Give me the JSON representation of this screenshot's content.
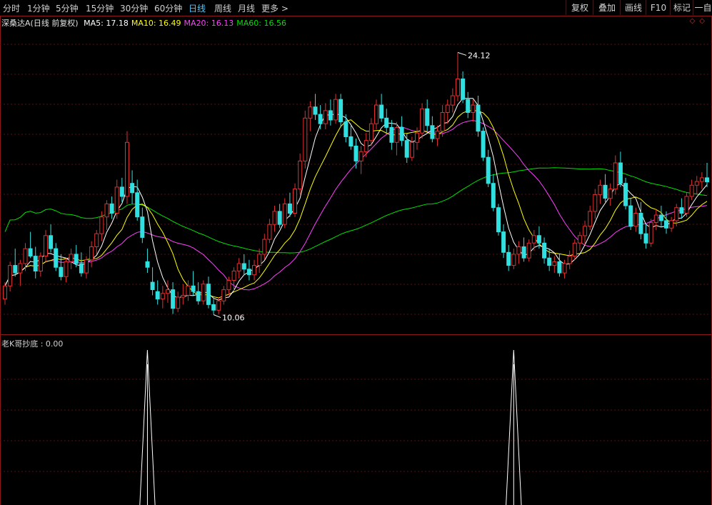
{
  "toolbar": {
    "periods": [
      "分时",
      "1分钟",
      "5分钟",
      "15分钟",
      "30分钟",
      "60分钟",
      "日线",
      "周线",
      "月线",
      "更多 >"
    ],
    "active_period": "日线",
    "right_buttons": [
      "复权",
      "叠加",
      "画线",
      "F10",
      "标记",
      "一自"
    ]
  },
  "main_chart": {
    "title": "深桑达A(日线 前复权)",
    "ma": [
      {
        "label": "MA5: 17.18",
        "color": "#ffffff"
      },
      {
        "label": "MA10: 16.49",
        "color": "#ffff00"
      },
      {
        "label": "MA20: 16.13",
        "color": "#ff40ff"
      },
      {
        "label": "MA60: 16.56",
        "color": "#00e000"
      }
    ],
    "diamonds": "◇◇"
  },
  "sub_chart": {
    "label": "老K哥抄底 : 0.00"
  },
  "chart_data": {
    "type": "candlestick",
    "title": "深桑达A(日线 前复权)",
    "price_range": [
      9.2,
      25.4
    ],
    "high_annotation": "24.12",
    "low_annotation": "10.06",
    "candle_colors": {
      "up": "#e03030",
      "down": "#30e0e0"
    },
    "ma_colors": {
      "MA5": "#ffffff",
      "MA10": "#ffff00",
      "MA20": "#ff40ff",
      "MA60": "#00e000"
    },
    "candles": [
      [
        10.9,
        11.8,
        10.6,
        11.6
      ],
      [
        11.6,
        12.9,
        11.3,
        12.7
      ],
      [
        12.7,
        13.6,
        12.1,
        12.3
      ],
      [
        12.3,
        13.0,
        11.6,
        12.8
      ],
      [
        12.8,
        13.9,
        12.4,
        13.6
      ],
      [
        13.6,
        14.5,
        13.1,
        13.2
      ],
      [
        13.2,
        13.7,
        12.0,
        12.4
      ],
      [
        12.4,
        13.4,
        12.1,
        13.2
      ],
      [
        13.2,
        14.6,
        12.9,
        14.3
      ],
      [
        14.3,
        14.9,
        13.4,
        13.6
      ],
      [
        13.6,
        13.9,
        12.4,
        12.6
      ],
      [
        12.6,
        13.3,
        11.9,
        12.1
      ],
      [
        12.1,
        13.1,
        11.8,
        12.9
      ],
      [
        12.9,
        13.6,
        12.5,
        13.3
      ],
      [
        13.3,
        13.8,
        12.6,
        12.8
      ],
      [
        12.8,
        13.4,
        12.1,
        12.3
      ],
      [
        12.3,
        13.2,
        12.0,
        13.0
      ],
      [
        13.0,
        14.0,
        12.6,
        13.7
      ],
      [
        13.7,
        14.6,
        13.3,
        14.4
      ],
      [
        14.4,
        15.6,
        14.0,
        15.3
      ],
      [
        15.3,
        16.2,
        14.6,
        16.0
      ],
      [
        16.0,
        16.4,
        15.2,
        15.5
      ],
      [
        15.5,
        17.3,
        15.2,
        16.9
      ],
      [
        16.9,
        17.4,
        16.1,
        16.4
      ],
      [
        16.4,
        19.9,
        16.0,
        19.3
      ],
      [
        17.1,
        17.8,
        16.0,
        16.6
      ],
      [
        16.6,
        17.3,
        15.1,
        15.3
      ],
      [
        15.3,
        15.8,
        13.9,
        14.2
      ],
      [
        12.9,
        13.6,
        12.3,
        12.6
      ],
      [
        11.8,
        12.6,
        11.1,
        11.4
      ],
      [
        11.3,
        11.9,
        10.6,
        10.9
      ],
      [
        10.9,
        11.6,
        10.4,
        11.2
      ],
      [
        11.2,
        11.9,
        10.7,
        11.4
      ],
      [
        11.4,
        11.8,
        10.1,
        10.4
      ],
      [
        10.4,
        11.3,
        10.2,
        11.0
      ],
      [
        11.0,
        11.7,
        10.6,
        11.1
      ],
      [
        11.1,
        11.9,
        10.8,
        11.6
      ],
      [
        11.6,
        12.4,
        11.1,
        11.3
      ],
      [
        11.3,
        11.8,
        10.6,
        10.8
      ],
      [
        10.8,
        11.9,
        10.6,
        11.7
      ],
      [
        11.7,
        12.1,
        10.4,
        10.6
      ],
      [
        10.6,
        10.9,
        10.06,
        10.3
      ],
      [
        10.3,
        11.0,
        10.1,
        10.8
      ],
      [
        10.8,
        11.6,
        10.6,
        11.4
      ],
      [
        11.4,
        12.1,
        11.1,
        11.9
      ],
      [
        11.9,
        12.6,
        11.3,
        12.4
      ],
      [
        12.4,
        13.1,
        12.0,
        12.8
      ],
      [
        12.8,
        13.3,
        12.2,
        12.5
      ],
      [
        12.5,
        13.0,
        11.9,
        12.2
      ],
      [
        12.2,
        13.0,
        11.9,
        12.7
      ],
      [
        12.7,
        13.6,
        12.3,
        13.3
      ],
      [
        13.3,
        14.4,
        13.0,
        14.1
      ],
      [
        14.1,
        15.2,
        13.9,
        14.9
      ],
      [
        14.9,
        15.9,
        14.5,
        15.6
      ],
      [
        15.6,
        16.0,
        14.7,
        14.9
      ],
      [
        14.9,
        16.3,
        14.7,
        16.0
      ],
      [
        16.0,
        16.6,
        15.3,
        15.5
      ],
      [
        15.5,
        17.1,
        15.3,
        16.8
      ],
      [
        16.8,
        18.7,
        16.5,
        18.3
      ],
      [
        18.3,
        21.0,
        17.9,
        20.6
      ],
      [
        20.6,
        21.5,
        19.9,
        21.2
      ],
      [
        21.2,
        21.9,
        20.5,
        20.8
      ],
      [
        20.8,
        21.3,
        20.0,
        20.3
      ],
      [
        20.3,
        21.4,
        20.0,
        21.0
      ],
      [
        21.0,
        21.6,
        20.2,
        20.5
      ],
      [
        20.5,
        21.9,
        20.3,
        21.6
      ],
      [
        21.6,
        21.9,
        20.1,
        20.4
      ],
      [
        20.4,
        20.8,
        19.3,
        19.6
      ],
      [
        19.6,
        20.3,
        18.9,
        19.1
      ],
      [
        19.1,
        19.5,
        17.9,
        18.3
      ],
      [
        18.3,
        19.1,
        17.6,
        18.8
      ],
      [
        18.8,
        19.8,
        18.5,
        19.4
      ],
      [
        19.4,
        20.6,
        19.1,
        20.3
      ],
      [
        20.3,
        21.6,
        20.0,
        21.3
      ],
      [
        21.3,
        21.9,
        20.4,
        20.6
      ],
      [
        20.6,
        21.1,
        19.8,
        20.1
      ],
      [
        20.1,
        20.5,
        18.9,
        19.3
      ],
      [
        19.3,
        20.4,
        18.6,
        20.1
      ],
      [
        20.1,
        20.7,
        19.1,
        19.4
      ],
      [
        19.4,
        19.8,
        18.2,
        18.5
      ],
      [
        18.5,
        19.6,
        18.3,
        19.3
      ],
      [
        19.3,
        20.1,
        18.9,
        19.8
      ],
      [
        19.8,
        21.4,
        19.5,
        21.1
      ],
      [
        21.1,
        21.6,
        19.9,
        20.2
      ],
      [
        20.2,
        20.7,
        19.3,
        19.5
      ],
      [
        19.5,
        20.2,
        19.1,
        19.9
      ],
      [
        19.9,
        21.3,
        19.6,
        20.9
      ],
      [
        20.9,
        21.6,
        20.3,
        21.3
      ],
      [
        21.3,
        22.2,
        20.9,
        21.8
      ],
      [
        21.8,
        24.12,
        21.5,
        22.7
      ],
      [
        22.7,
        23.1,
        21.4,
        21.6
      ],
      [
        21.6,
        22.0,
        20.6,
        20.9
      ],
      [
        20.9,
        21.6,
        20.4,
        21.3
      ],
      [
        21.3,
        21.8,
        19.6,
        19.9
      ],
      [
        19.9,
        20.1,
        18.3,
        18.5
      ],
      [
        18.5,
        18.9,
        16.9,
        17.1
      ],
      [
        17.1,
        17.6,
        15.6,
        15.8
      ],
      [
        15.8,
        16.0,
        14.3,
        14.5
      ],
      [
        14.5,
        14.9,
        13.1,
        13.4
      ],
      [
        13.4,
        13.8,
        12.4,
        12.7
      ],
      [
        12.7,
        13.6,
        12.5,
        13.3
      ],
      [
        13.3,
        14.0,
        12.8,
        13.7
      ],
      [
        13.7,
        14.2,
        12.9,
        13.1
      ],
      [
        13.1,
        14.1,
        12.9,
        13.9
      ],
      [
        13.9,
        14.6,
        13.5,
        14.3
      ],
      [
        14.3,
        14.8,
        13.6,
        13.9
      ],
      [
        13.9,
        14.2,
        12.8,
        13.1
      ],
      [
        13.1,
        13.6,
        12.4,
        12.7
      ],
      [
        12.7,
        13.2,
        12.3,
        12.9
      ],
      [
        12.9,
        13.3,
        12.1,
        12.3
      ],
      [
        12.3,
        13.0,
        12.0,
        12.8
      ],
      [
        12.8,
        13.5,
        12.5,
        13.2
      ],
      [
        13.2,
        14.1,
        13.0,
        13.9
      ],
      [
        13.9,
        14.5,
        13.5,
        14.3
      ],
      [
        14.3,
        15.1,
        13.8,
        14.8
      ],
      [
        14.8,
        15.9,
        14.6,
        15.6
      ],
      [
        15.6,
        16.8,
        15.2,
        16.5
      ],
      [
        16.5,
        17.3,
        16.0,
        17.0
      ],
      [
        17.0,
        17.6,
        16.1,
        16.3
      ],
      [
        16.3,
        17.1,
        15.9,
        16.8
      ],
      [
        16.8,
        18.6,
        16.5,
        18.2
      ],
      [
        18.2,
        18.8,
        16.9,
        17.1
      ],
      [
        17.1,
        17.4,
        15.7,
        15.9
      ],
      [
        15.9,
        16.3,
        14.6,
        14.8
      ],
      [
        14.8,
        15.8,
        14.5,
        15.5
      ],
      [
        15.5,
        16.1,
        14.1,
        14.4
      ],
      [
        14.4,
        14.9,
        13.6,
        13.9
      ],
      [
        13.9,
        15.2,
        13.7,
        15.0
      ],
      [
        15.0,
        15.7,
        14.6,
        15.4
      ],
      [
        15.4,
        15.9,
        14.8,
        15.1
      ],
      [
        15.1,
        15.6,
        14.4,
        14.7
      ],
      [
        14.7,
        15.3,
        14.5,
        15.1
      ],
      [
        15.1,
        16.0,
        14.8,
        15.8
      ],
      [
        15.8,
        16.3,
        15.2,
        15.5
      ],
      [
        15.5,
        16.6,
        15.3,
        16.4
      ],
      [
        16.4,
        17.3,
        16.2,
        17.0
      ],
      [
        17.0,
        17.5,
        16.5,
        17.2
      ],
      [
        17.2,
        17.7,
        16.8,
        17.4
      ],
      [
        17.4,
        18.2,
        16.9,
        17.18
      ]
    ],
    "sub_signal": {
      "name": "老K哥抄底",
      "value": "0.00",
      "spikes_at_candle_index": [
        28,
        100
      ],
      "range": [
        0,
        1
      ]
    }
  }
}
